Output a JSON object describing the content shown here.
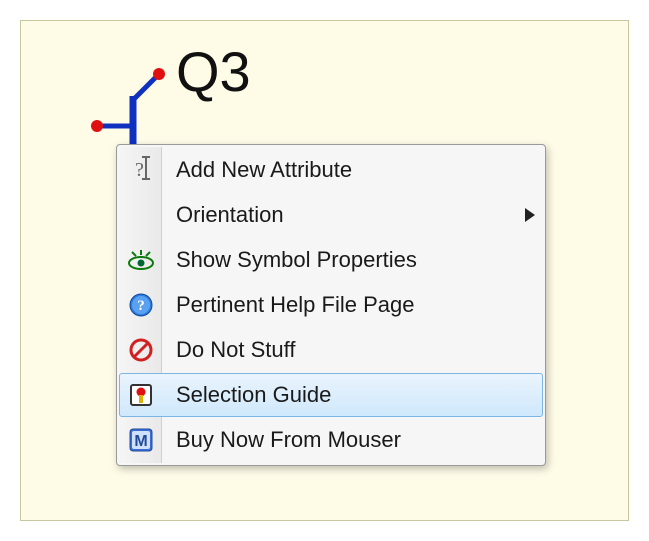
{
  "component": {
    "designator": "Q3"
  },
  "context_menu": {
    "items": [
      {
        "id": "add-attr",
        "icon": "attribute-icon",
        "label": "Add New Attribute",
        "submenu": false,
        "hover": false
      },
      {
        "id": "orient",
        "icon": "",
        "label": "Orientation",
        "submenu": true,
        "hover": false
      },
      {
        "id": "show-props",
        "icon": "eye-icon",
        "label": "Show Symbol Properties",
        "submenu": false,
        "hover": false
      },
      {
        "id": "help-page",
        "icon": "help-icon",
        "label": "Pertinent Help File Page",
        "submenu": false,
        "hover": false
      },
      {
        "id": "dns",
        "icon": "no-stuff-icon",
        "label": "Do Not Stuff",
        "submenu": false,
        "hover": false
      },
      {
        "id": "sel-guide",
        "icon": "guide-icon",
        "label": "Selection Guide",
        "submenu": false,
        "hover": true
      },
      {
        "id": "buy-mouser",
        "icon": "mouser-icon",
        "label": "Buy Now From Mouser",
        "submenu": false,
        "hover": false
      }
    ]
  }
}
